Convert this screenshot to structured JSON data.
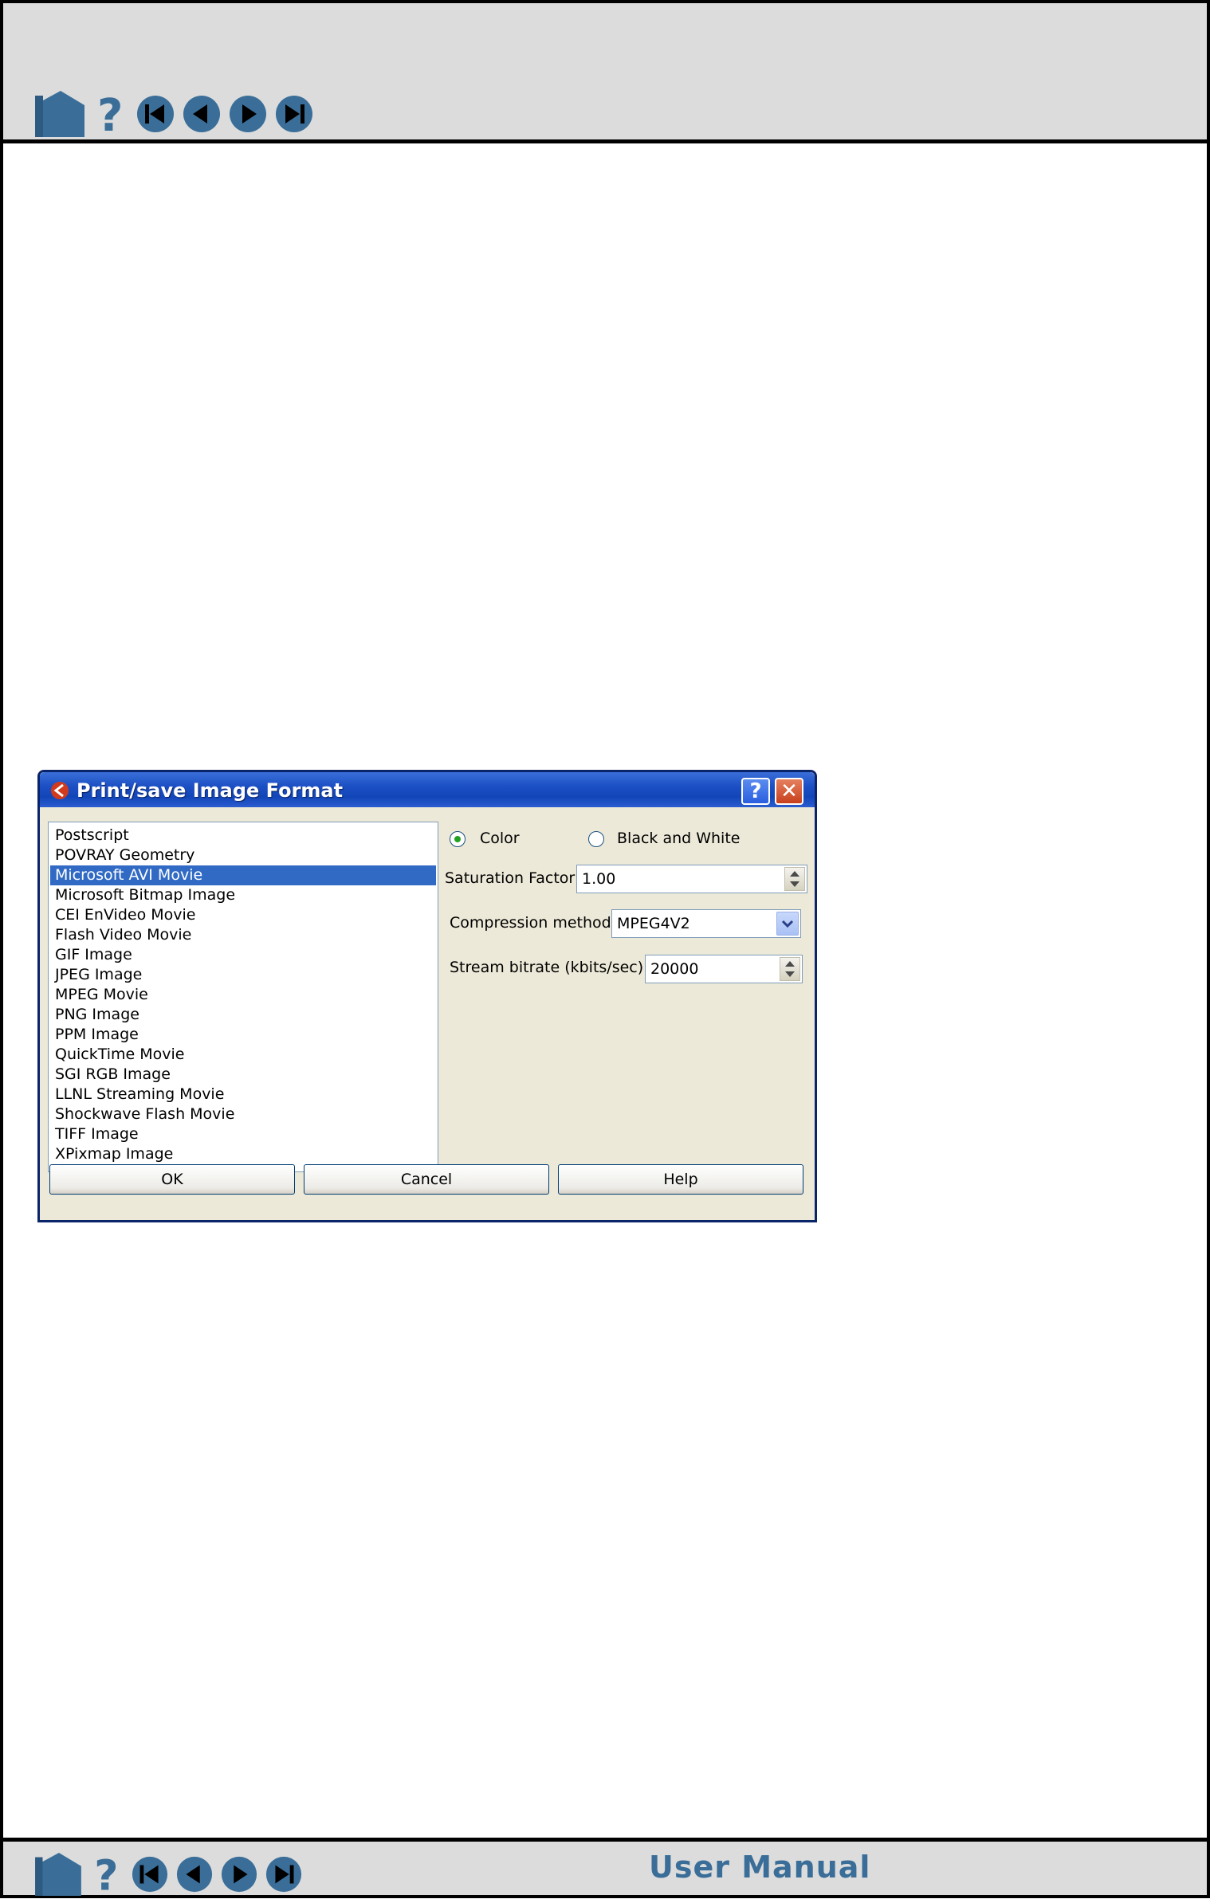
{
  "footer": {
    "manual_title": "User Manual"
  },
  "nav": {
    "icons": [
      "home-icon",
      "help-icon",
      "first-page-icon",
      "previous-page-icon",
      "next-page-icon",
      "last-page-icon"
    ]
  },
  "dialog": {
    "title": "Print/save Image Format",
    "formats": [
      "Postscript",
      "POVRAY Geometry",
      "Microsoft AVI Movie",
      "Microsoft Bitmap Image",
      "CEI EnVideo Movie",
      "Flash Video Movie",
      "GIF Image",
      "JPEG Image",
      "MPEG Movie",
      "PNG Image",
      "PPM Image",
      "QuickTime Movie",
      "SGI RGB Image",
      "LLNL Streaming Movie",
      "Shockwave Flash Movie",
      "TIFF Image",
      "XPixmap Image"
    ],
    "selected_format": "Microsoft AVI Movie",
    "color_mode": {
      "color_label": "Color",
      "bw_label": "Black and White",
      "selected": "Color"
    },
    "saturation": {
      "label": "Saturation Factor",
      "value": "1.00"
    },
    "compression": {
      "label": "Compression method",
      "value": "MPEG4V2"
    },
    "bitrate": {
      "label": "Stream bitrate (kbits/sec)",
      "value": "20000"
    },
    "buttons": {
      "ok": "OK",
      "cancel": "Cancel",
      "help": "Help"
    }
  },
  "colors": {
    "accent_blue": "#316ac5",
    "nav_icon_blue": "#3a6e98",
    "dialog_bg": "#ece9d8"
  }
}
